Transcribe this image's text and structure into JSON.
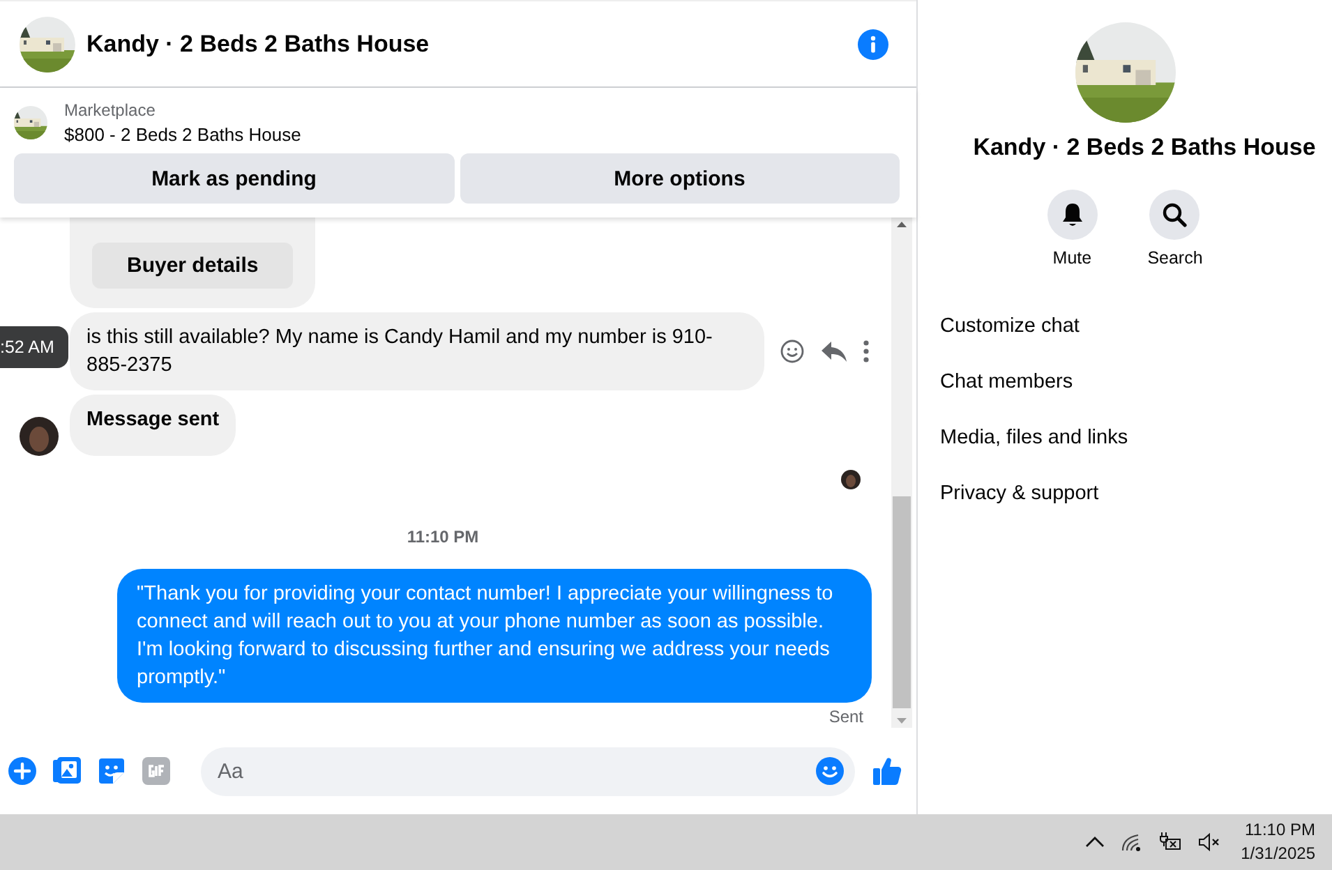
{
  "header": {
    "title": "Kandy · 2 Beds 2 Baths House"
  },
  "listing": {
    "source": "Marketplace",
    "title": "$800 - 2 Beds 2 Baths House",
    "buttons": [
      "Mark as pending",
      "More options"
    ]
  },
  "messages": [
    {
      "kind": "card",
      "button": "Buyer details"
    },
    {
      "kind": "incoming",
      "text": "is this still available? My name is Candy Hamil and my number is 910-885-2375",
      "tooltip": ":52 AM"
    },
    {
      "kind": "notice",
      "text": "Message sent"
    },
    {
      "kind": "receipt"
    },
    {
      "kind": "timestamp",
      "text": "11:10 PM"
    },
    {
      "kind": "outgoing",
      "text": "\"Thank you for providing your contact number! I appreciate your willingness to connect and will reach out to you at your phone number as soon as possible. I'm looking forward to discussing further and ensuring we address your needs promptly.\"",
      "status": "Sent"
    }
  ],
  "composer": {
    "placeholder": "Aa"
  },
  "details": {
    "title": "Kandy · 2 Beds 2 Baths House",
    "actions": [
      {
        "kind": "mute",
        "label": "Mute"
      },
      {
        "kind": "search",
        "label": "Search"
      }
    ],
    "menu": [
      "Customize chat",
      "Chat members",
      "Media, files and links",
      "Privacy & support"
    ]
  },
  "taskbar": {
    "time": "11:10 PM",
    "date": "1/31/2025"
  }
}
